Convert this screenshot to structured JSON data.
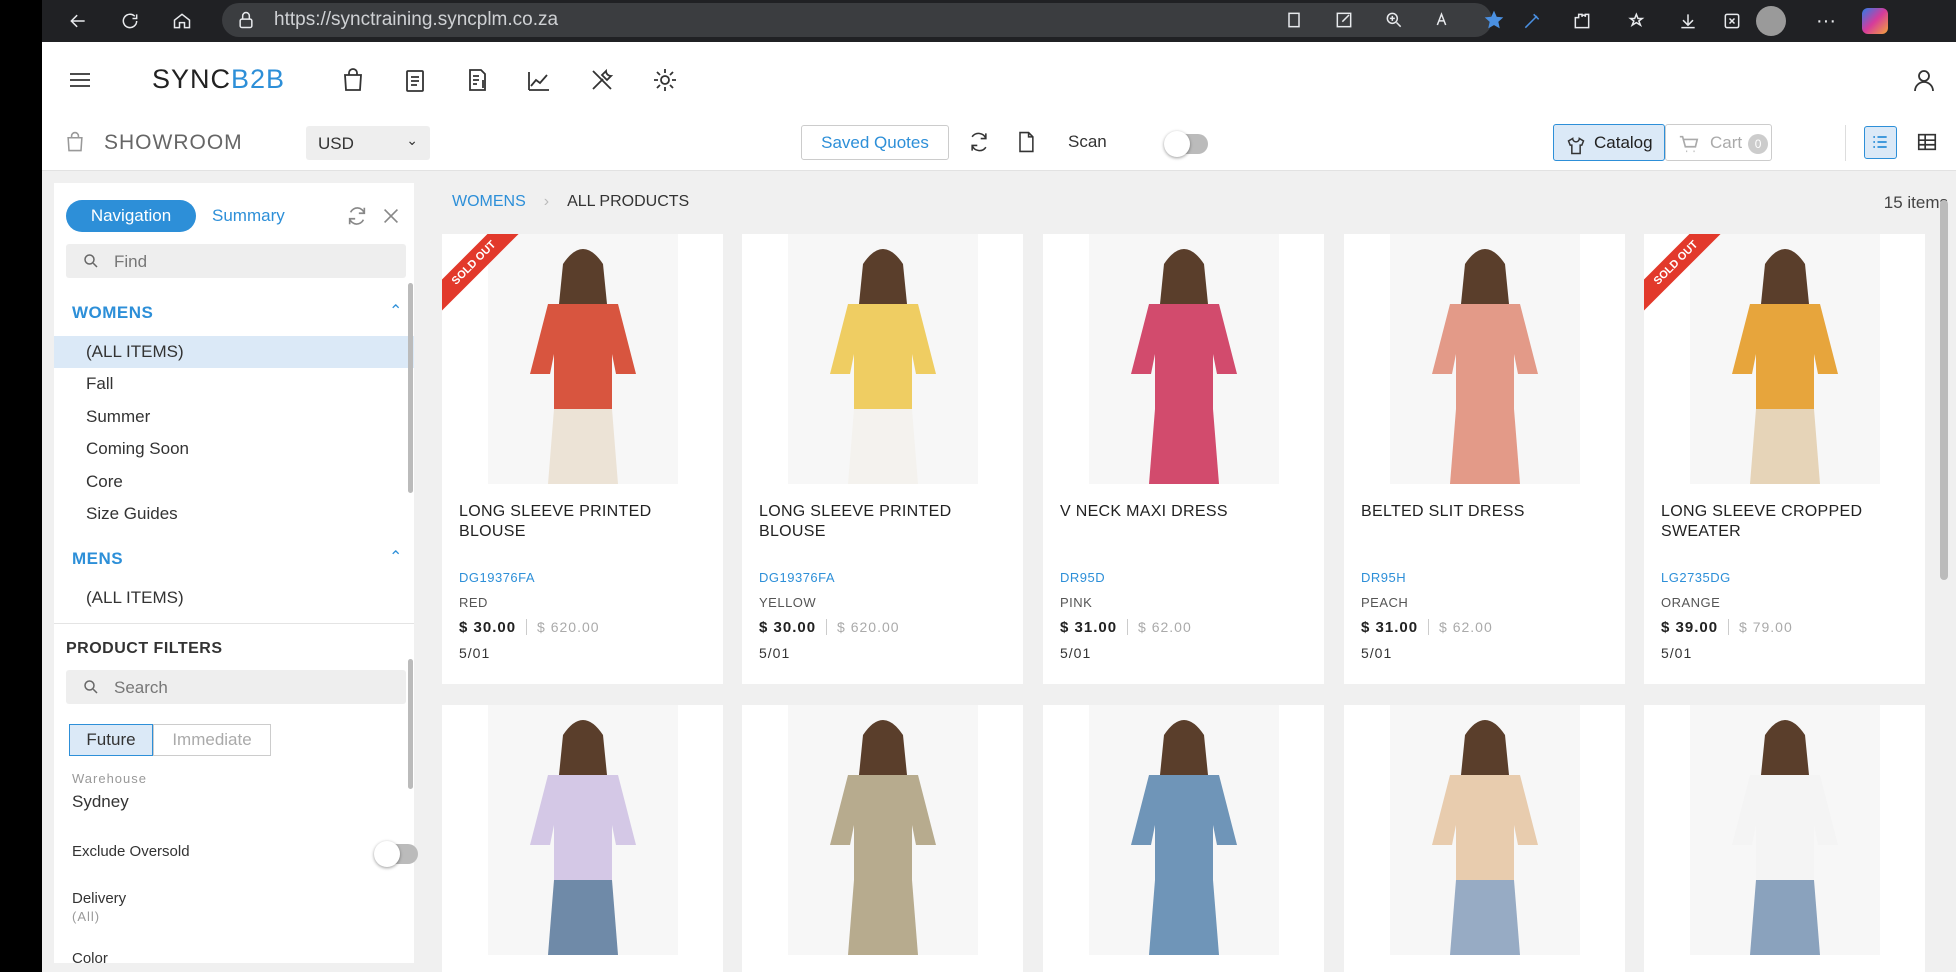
{
  "browser": {
    "url": "https://synctraining.syncplm.co.za"
  },
  "app": {
    "brand_sync": "SYNC",
    "brand_b2b": "B2B"
  },
  "toolbar": {
    "showroom_label": "SHOWROOM",
    "currency": "USD",
    "saved_quotes": "Saved Quotes",
    "scan_label": "Scan",
    "scan_on": false,
    "catalog_label": "Catalog",
    "cart_label": "Cart",
    "cart_count": "0"
  },
  "sidebar": {
    "tabs": [
      "Navigation",
      "Summary"
    ],
    "find_placeholder": "Find",
    "sections": [
      {
        "title": "WOMENS",
        "items": [
          "(ALL ITEMS)",
          "Fall",
          "Summer",
          "Coming Soon",
          "Core",
          "Size Guides"
        ]
      },
      {
        "title": "MENS",
        "items": [
          "(ALL ITEMS)"
        ]
      }
    ],
    "filters": {
      "title": "PRODUCT FILTERS",
      "search_placeholder": "Search",
      "future": "Future",
      "immediate": "Immediate",
      "warehouse_label": "Warehouse",
      "warehouse_value": "Sydney",
      "exclude_oversold": "Exclude Oversold",
      "delivery_label": "Delivery",
      "delivery_value": "(All)",
      "color_label": "Color"
    }
  },
  "breadcrumb": {
    "root": "WOMENS",
    "current": "ALL PRODUCTS"
  },
  "item_count": "15 items",
  "products": [
    {
      "name": "LONG SLEEVE PRINTED BLOUSE",
      "code": "DG19376FA",
      "color": "RED",
      "price": "$ 30.00",
      "msrp": "$ 620.00",
      "date": "5/01",
      "sold_out": "SOLD OUT",
      "top": "#d8553f",
      "bottom": "#ece3d6"
    },
    {
      "name": "LONG SLEEVE PRINTED BLOUSE",
      "code": "DG19376FA",
      "color": "YELLOW",
      "price": "$ 30.00",
      "msrp": "$ 620.00",
      "date": "5/01",
      "sold_out": "",
      "top": "#efcd62",
      "bottom": "#f4f2ee"
    },
    {
      "name": "V NECK MAXI DRESS",
      "code": "DR95D",
      "color": "PINK",
      "price": "$ 31.00",
      "msrp": "$ 62.00",
      "date": "5/01",
      "sold_out": "",
      "top": "#d24b6d",
      "bottom": "#d24b6d"
    },
    {
      "name": "BELTED SLIT DRESS",
      "code": "DR95H",
      "color": "PEACH",
      "price": "$ 31.00",
      "msrp": "$ 62.00",
      "date": "5/01",
      "sold_out": "",
      "top": "#e39a88",
      "bottom": "#e39a88"
    },
    {
      "name": "LONG SLEEVE CROPPED SWEATER",
      "code": "LG2735DG",
      "color": "ORANGE",
      "price": "$ 39.00",
      "msrp": "$ 79.00",
      "date": "5/01",
      "sold_out": "SOLD OUT",
      "top": "#e7a53c",
      "bottom": "#e6d4b8"
    },
    {
      "top": "#d4c8e6",
      "bottom": "#6f8aa8"
    },
    {
      "top": "#b7ab8e",
      "bottom": "#b7ab8e"
    },
    {
      "top": "#6f95b8",
      "bottom": "#6f95b8"
    },
    {
      "top": "#e8ccae",
      "bottom": "#97abc4"
    },
    {
      "top": "#f4f4f4",
      "bottom": "#8aa2bd"
    }
  ]
}
